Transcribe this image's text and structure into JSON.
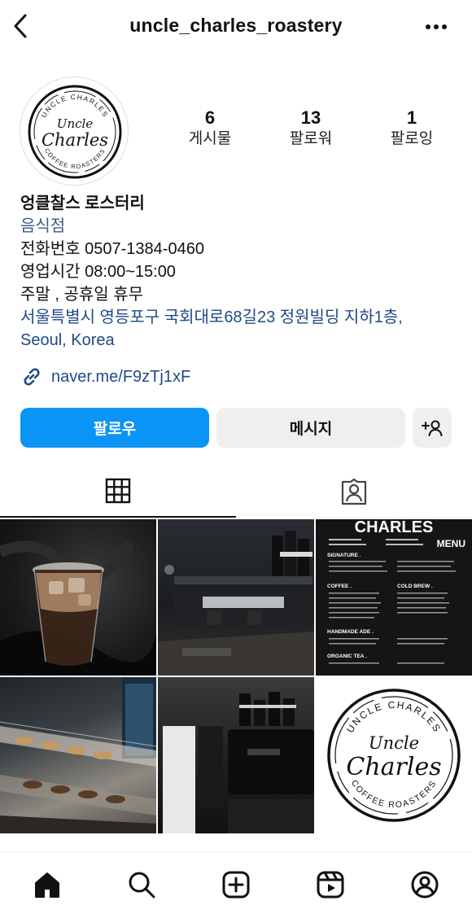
{
  "header": {
    "username": "uncle_charles_roastery"
  },
  "profile": {
    "avatar_logo": {
      "top_text": "UNCLE CHARLES",
      "script_line1": "Uncle",
      "script_line2": "Charles",
      "bottom_text": "COFFEE ROASTERS"
    },
    "stats": [
      {
        "value": "6",
        "label": "게시물"
      },
      {
        "value": "13",
        "label": "팔로워"
      },
      {
        "value": "1",
        "label": "팔로잉"
      }
    ],
    "name": "엉클찰스 로스터리",
    "category": "음식점",
    "phone": "전화번호 0507-1384-0460",
    "hours": "영업시간 08:00~15:00",
    "closed": "주말 , 공휴일 휴무",
    "address_line1": "서울특별시 영등포구 국회대로68길23 정원빌딩 지하1층,",
    "address_line2": "Seoul, Korea",
    "link": "naver.me/F9zTj1xF"
  },
  "actions": {
    "follow": "팔로우",
    "message": "메시지"
  },
  "tabs": {
    "active": "grid"
  },
  "grid": {
    "menu_post": {
      "brand": "CHARLES",
      "menu": "MENU",
      "signature": "SIGNATURE .",
      "coffee": "COFFEE .",
      "cold_brew": "COLD BREW .",
      "handmade": "HANDMADE ADE .",
      "organic_tea": "ORGANIC TEA ."
    }
  },
  "bottom_nav": [
    "home-icon",
    "search-icon",
    "create-icon",
    "reels-icon",
    "profile-icon"
  ]
}
